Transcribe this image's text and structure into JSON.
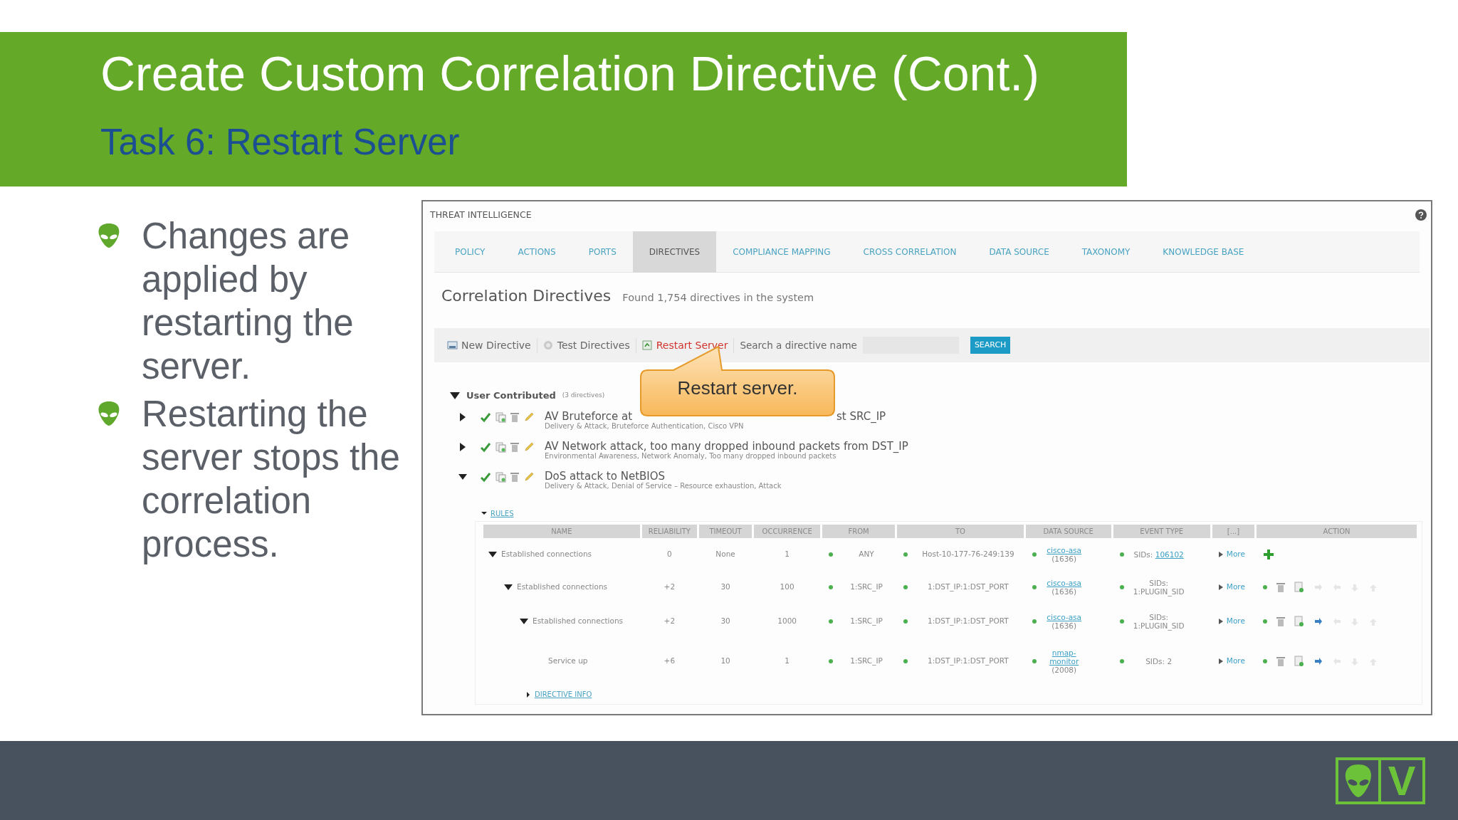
{
  "slide": {
    "title": "Create Custom Correlation Directive (Cont.)",
    "subtitle": "Task 6: Restart Server"
  },
  "bullets": [
    "Changes are applied by restarting the server.",
    "Restarting the server stops the correlation process."
  ],
  "screenshot": {
    "window_title": "THREAT INTELLIGENCE",
    "tabs": [
      {
        "label": "POLICY",
        "selected": false
      },
      {
        "label": "ACTIONS",
        "selected": false
      },
      {
        "label": "PORTS",
        "selected": false
      },
      {
        "label": "DIRECTIVES",
        "selected": true
      },
      {
        "label": "COMPLIANCE MAPPING",
        "selected": false
      },
      {
        "label": "CROSS CORRELATION",
        "selected": false
      },
      {
        "label": "DATA SOURCE",
        "selected": false
      },
      {
        "label": "TAXONOMY",
        "selected": false
      },
      {
        "label": "KNOWLEDGE BASE",
        "selected": false
      }
    ],
    "heading": "Correlation Directives",
    "found_text": "Found 1,754 directives in the system",
    "toolbar": [
      {
        "label": "New Directive",
        "kind": "new",
        "highlighted": false
      },
      {
        "label": "Test Directives",
        "kind": "test",
        "highlighted": false
      },
      {
        "label": "Restart Server",
        "kind": "restart",
        "highlighted": true
      }
    ],
    "search": {
      "label": "Search a directive name",
      "button": "SEARCH"
    },
    "group": {
      "label": "User Contributed",
      "count": "(3 directives)",
      "expanded": true
    },
    "directives": [
      {
        "name": "AV Bruteforce at",
        "name_tail": "st SRC_IP",
        "subtitle": "Delivery & Attack, Bruteforce Authentication, Cisco VPN",
        "expanded": false
      },
      {
        "name": "AV Network attack, too many dropped inbound packets from DST_IP",
        "subtitle": "Environmental Awareness, Network Anomaly, Too many dropped inbound packets",
        "expanded": false
      },
      {
        "name": "DoS attack to NetBIOS",
        "subtitle": "Delivery & Attack, Denial of Service – Resource exhaustion, Attack",
        "expanded": true
      }
    ],
    "rules_label": "RULES",
    "rules_expanded": true,
    "columns": [
      "NAME",
      "RELIABILITY",
      "TIMEOUT",
      "OCCURRENCE",
      "FROM",
      "TO",
      "DATA SOURCE",
      "EVENT TYPE",
      "[...]",
      "ACTION"
    ],
    "rules": [
      {
        "name": "Established connections",
        "reliability": "0",
        "timeout": "None",
        "occurrence": "1",
        "from": "ANY",
        "to": "Host-10-177-76-249:139",
        "data_source": "cisco-asa",
        "data_source_count": "(1636)",
        "event_label": "SIDs:",
        "event_value": "106102",
        "event_linked": true,
        "more": "More",
        "kind": "add",
        "expanded": true,
        "children": [
          {
            "name": "Established connections",
            "reliability": "+2",
            "timeout": "30",
            "occurrence": "100",
            "from": "1:SRC_IP",
            "to": "1:DST_IP:1:DST_PORT",
            "data_source": "cisco-asa",
            "data_source_count": "(1636)",
            "event_label": "SIDs:",
            "event_value": "1:PLUGIN_SID",
            "event_linked": false,
            "more": "More",
            "kind": "edit",
            "indent_enabled": false,
            "expanded": true,
            "children": [
              {
                "name": "Established connections",
                "reliability": "+2",
                "timeout": "30",
                "occurrence": "1000",
                "from": "1:SRC_IP",
                "to": "1:DST_IP:1:DST_PORT",
                "data_source": "cisco-asa",
                "data_source_count": "(1636)",
                "event_label": "SIDs:",
                "event_value": "1:PLUGIN_SID",
                "event_linked": false,
                "more": "More",
                "kind": "edit",
                "indent_enabled": true,
                "expanded": true,
                "children": [
                  {
                    "name": "Service up",
                    "reliability": "+6",
                    "timeout": "10",
                    "occurrence": "1",
                    "from": "1:SRC_IP",
                    "to": "1:DST_IP:1:DST_PORT",
                    "data_source": "nmap-monitor",
                    "data_source_count": "(2008)",
                    "event_label": "SIDs:",
                    "event_value": "2",
                    "event_linked": false,
                    "more": "More",
                    "kind": "edit",
                    "indent_enabled": true
                  }
                ]
              }
            ]
          }
        ]
      }
    ],
    "directive_info": "DIRECTIVE INFO",
    "directive_info_expanded": false
  },
  "callout": "Restart server.",
  "logo": {
    "letter": "V"
  }
}
